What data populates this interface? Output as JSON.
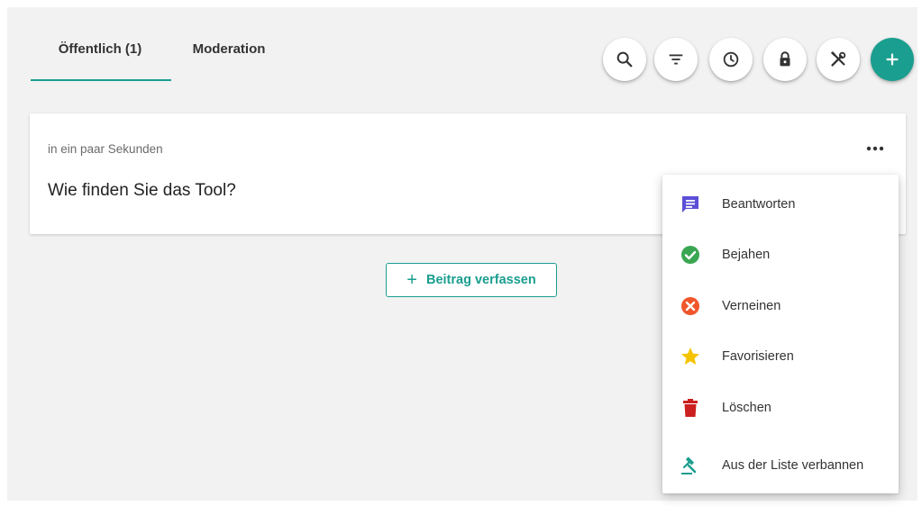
{
  "tabs": [
    {
      "label": "Öffentlich (1)",
      "active": true
    },
    {
      "label": "Moderation",
      "active": false
    }
  ],
  "toolbar": {
    "icons": [
      "search-icon",
      "filter-icon",
      "clock-icon",
      "lock-icon",
      "tools-icon",
      "plus-icon"
    ]
  },
  "post": {
    "time": "in ein paar Sekunden",
    "question": "Wie finden Sie das Tool?",
    "more_icon": "more-dots-icon"
  },
  "compose": {
    "label": "Beitrag verfassen",
    "plus": "+"
  },
  "menu": {
    "items": [
      {
        "label": "Beantworten",
        "icon": "comment-icon",
        "color": "#5c4ed6"
      },
      {
        "label": "Bejahen",
        "icon": "check-circle-icon",
        "color": "#3aa652"
      },
      {
        "label": "Verneinen",
        "icon": "cancel-circle-icon",
        "color": "#f0562a"
      },
      {
        "label": "Favorisieren",
        "icon": "star-icon",
        "color": "#f5c400"
      },
      {
        "label": "Löschen",
        "icon": "trash-icon",
        "color": "#cc1f1f"
      },
      {
        "label": "Aus der Liste verbannen",
        "icon": "gavel-icon",
        "color": "#1a9e8f"
      }
    ]
  },
  "colors": {
    "accent": "#1a9e8f",
    "background": "#f2f2f2"
  }
}
